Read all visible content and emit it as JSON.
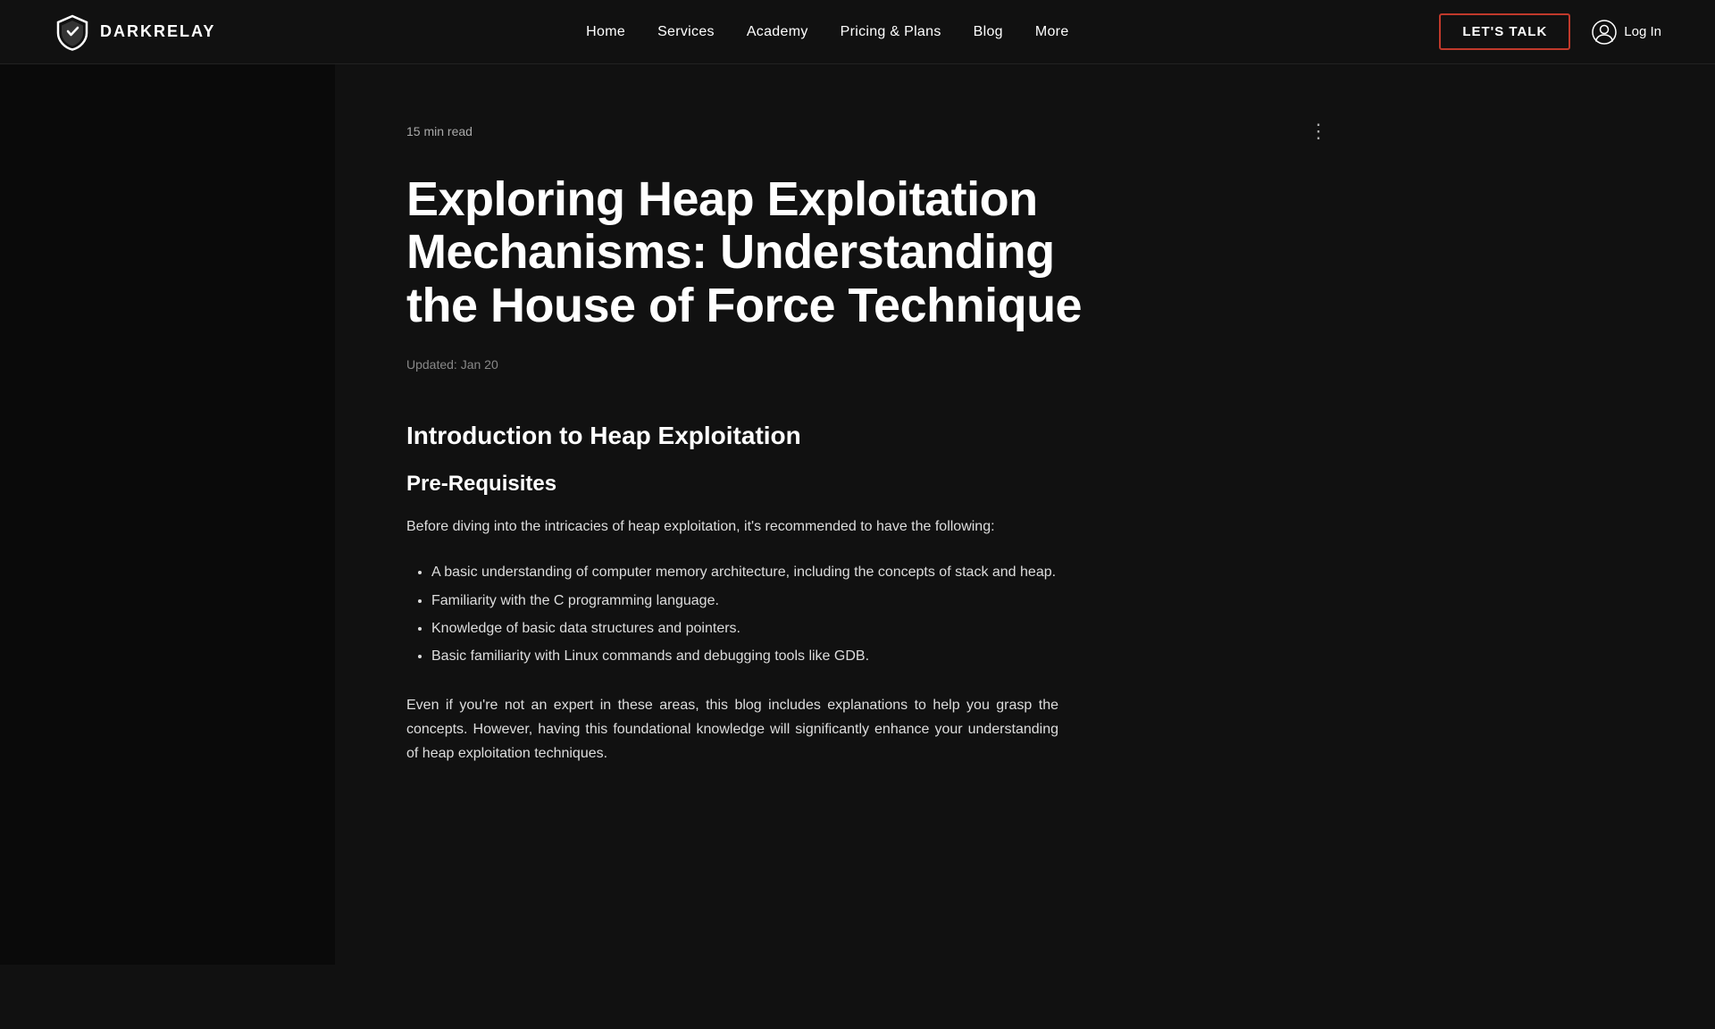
{
  "logo": {
    "text": "DARKRELAY"
  },
  "nav": {
    "items": [
      {
        "label": "Home",
        "id": "home"
      },
      {
        "label": "Services",
        "id": "services"
      },
      {
        "label": "Academy",
        "id": "academy"
      },
      {
        "label": "Pricing & Plans",
        "id": "pricing"
      },
      {
        "label": "Blog",
        "id": "blog"
      },
      {
        "label": "More",
        "id": "more"
      }
    ]
  },
  "header": {
    "cta_label": "LET'S TALK",
    "login_label": "Log In"
  },
  "article": {
    "read_time": "15 min read",
    "title": "Exploring Heap Exploitation Mechanisms: Understanding the House of Force Technique",
    "updated": "Updated: Jan 20",
    "section1_heading": "Introduction to Heap Exploitation",
    "section2_heading": "Pre-Requisites",
    "intro_text": "Before diving into the intricacies of heap exploitation, it's recommended to have the following:",
    "bullets": [
      "A basic understanding of computer memory architecture, including the concepts of stack and heap.",
      "Familiarity with the C programming language.",
      "Knowledge of basic data structures and pointers.",
      "Basic familiarity with Linux commands and debugging tools like GDB."
    ],
    "closing_text": "Even if you're not an expert in these areas, this blog includes explanations to help you grasp the concepts. However, having this foundational knowledge will significantly enhance your understanding of heap exploitation techniques."
  }
}
